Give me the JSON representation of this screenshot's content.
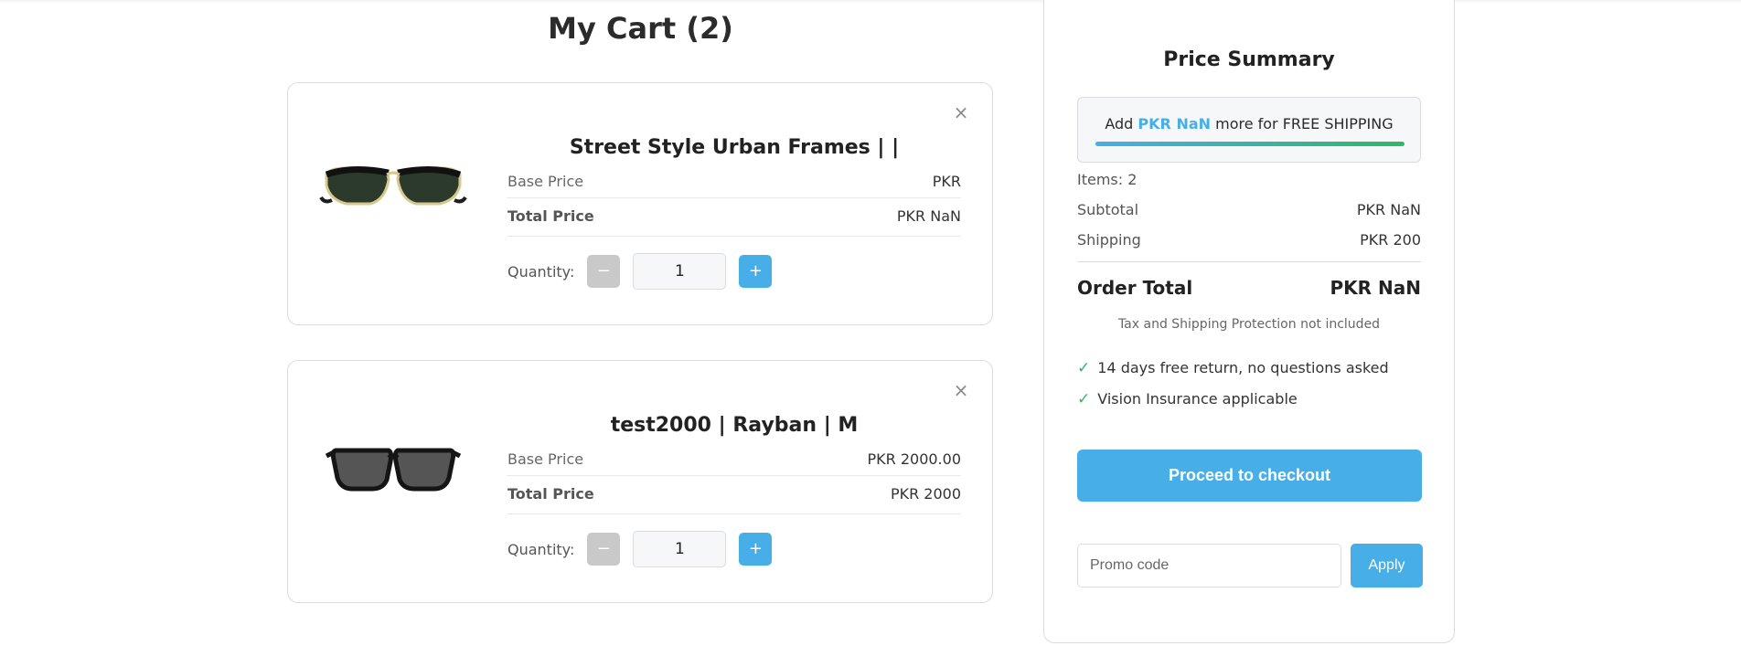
{
  "cart": {
    "title": "My Cart (2)",
    "items": [
      {
        "name": "Street Style Urban Frames | |",
        "base_price_label": "Base Price",
        "base_price": "PKR",
        "total_price_label": "Total Price",
        "total_price": "PKR NaN",
        "quantity_label": "Quantity:",
        "quantity": "1",
        "remove_icon": "close-icon",
        "minus_label": "−",
        "plus_label": "+"
      },
      {
        "name": "test2000 | Rayban | M",
        "base_price_label": "Base Price",
        "base_price": "PKR 2000.00",
        "total_price_label": "Total Price",
        "total_price": "PKR 2000",
        "quantity_label": "Quantity:",
        "quantity": "1",
        "remove_icon": "close-icon",
        "minus_label": "−",
        "plus_label": "+"
      }
    ]
  },
  "summary": {
    "title": "Price Summary",
    "shipping_prefix": "Add ",
    "shipping_amount": "PKR NaN",
    "shipping_suffix": " more for FREE SHIPPING",
    "shipping_progress": 1.0,
    "items_count": "Items: 2",
    "subtotal_label": "Subtotal",
    "subtotal_value": "PKR NaN",
    "shipping_label": "Shipping",
    "shipping_value": "PKR 200",
    "order_total_label": "Order Total",
    "order_total_value": "PKR NaN",
    "tax_note": "Tax and Shipping Protection not included",
    "perks": [
      "14 days free return, no questions asked",
      "Vision Insurance applicable"
    ],
    "checkout_label": "Proceed to checkout",
    "promo_placeholder": "Promo code",
    "apply_label": "Apply"
  },
  "colors": {
    "accent": "#48aee8",
    "success": "#2fb866",
    "disabled": "#c9c9c9"
  }
}
